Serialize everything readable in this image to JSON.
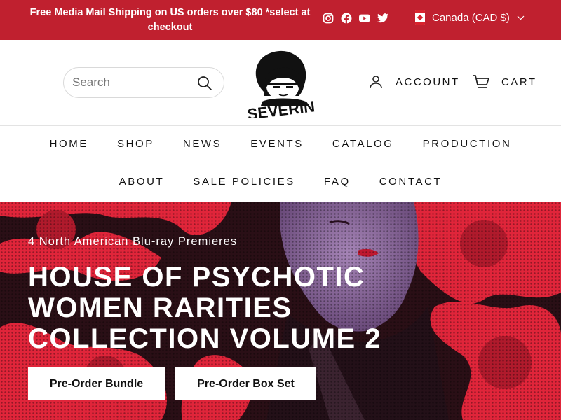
{
  "announcement": {
    "text": "Free Media Mail Shipping on US orders over $80 *select at checkout",
    "socials": [
      "instagram-icon",
      "facebook-icon",
      "youtube-icon",
      "twitter-icon"
    ],
    "currency": "Canada (CAD $)"
  },
  "header": {
    "search_placeholder": "Search",
    "logo_text": "SEVERIN",
    "account_label": "ACCOUNT",
    "cart_label": "CART"
  },
  "nav": {
    "row1": [
      "HOME",
      "SHOP",
      "NEWS",
      "EVENTS",
      "CATALOG",
      "PRODUCTION"
    ],
    "row2": [
      "ABOUT",
      "SALE POLICIES",
      "FAQ",
      "CONTACT"
    ]
  },
  "hero": {
    "subtitle": "4 North American Blu-ray Premieres",
    "title": "HOUSE OF PSYCHOTIC WOMEN RARITIES COLLECTION VOLUME 2",
    "buttons": [
      "Pre-Order Bundle",
      "Pre-Order Box Set"
    ]
  },
  "colors": {
    "accent": "#c0202f",
    "hero_red": "#e0253a",
    "hero_purple": "#8e6ba0"
  }
}
